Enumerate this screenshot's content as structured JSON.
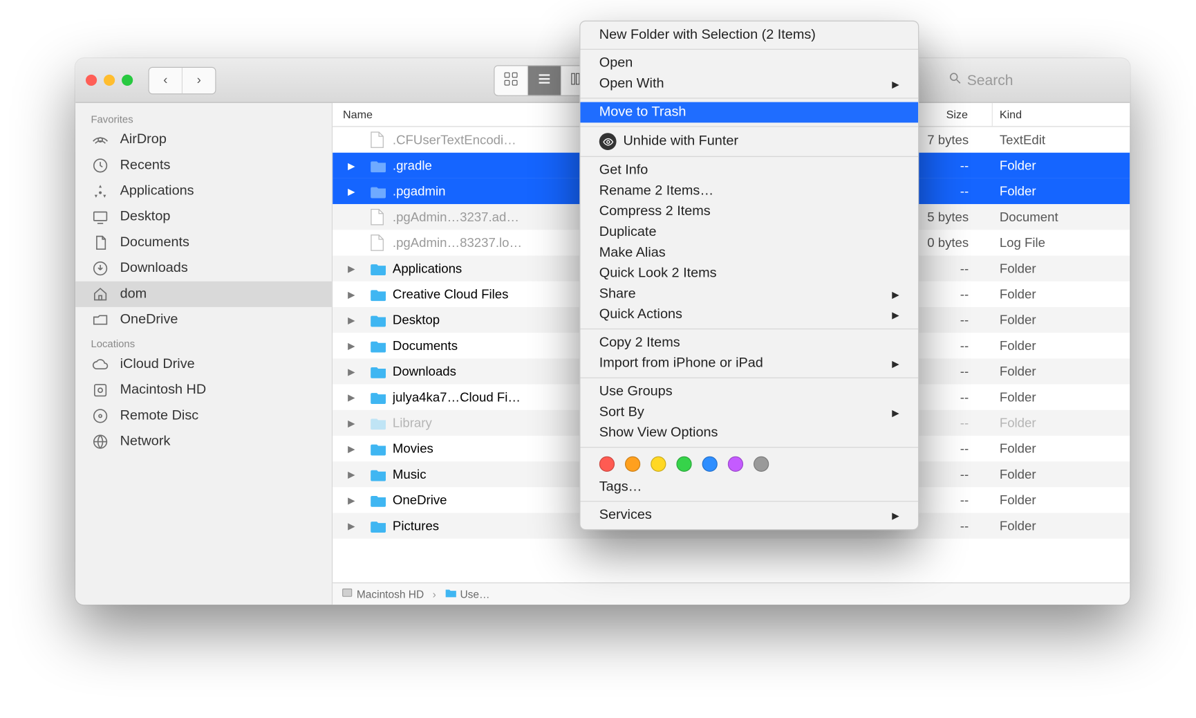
{
  "sidebar": {
    "groups": [
      {
        "header": "Favorites",
        "items": [
          {
            "icon": "airdrop",
            "label": "AirDrop"
          },
          {
            "icon": "recents",
            "label": "Recents"
          },
          {
            "icon": "apps",
            "label": "Applications"
          },
          {
            "icon": "desktop",
            "label": "Desktop"
          },
          {
            "icon": "documents",
            "label": "Documents"
          },
          {
            "icon": "downloads",
            "label": "Downloads"
          },
          {
            "icon": "home",
            "label": "dom",
            "selected": true
          },
          {
            "icon": "cloudfolder",
            "label": "OneDrive"
          }
        ]
      },
      {
        "header": "Locations",
        "items": [
          {
            "icon": "cloud",
            "label": "iCloud Drive"
          },
          {
            "icon": "disk",
            "label": "Macintosh HD"
          },
          {
            "icon": "remotedisc",
            "label": "Remote Disc"
          },
          {
            "icon": "network",
            "label": "Network"
          }
        ]
      }
    ]
  },
  "columns": {
    "name": "Name",
    "size": "Size",
    "kind": "Kind"
  },
  "rows": [
    {
      "expand": false,
      "sel": false,
      "type": "doc",
      "hidden": true,
      "name": ".CFUserTextEncodi…",
      "size": "7 bytes",
      "kind": "TextEdit"
    },
    {
      "expand": true,
      "sel": true,
      "type": "folder",
      "folderColor": "#1f6dff",
      "hidden": true,
      "name": ".gradle",
      "size": "--",
      "kind": "Folder"
    },
    {
      "expand": true,
      "sel": true,
      "type": "folder",
      "folderColor": "#1f6dff",
      "hidden": true,
      "name": ".pgadmin",
      "size": "--",
      "kind": "Folder"
    },
    {
      "expand": false,
      "sel": false,
      "type": "doc",
      "hidden": true,
      "name": ".pgAdmin…3237.ad…",
      "size": "5 bytes",
      "kind": "Document"
    },
    {
      "expand": false,
      "sel": false,
      "type": "doc",
      "hidden": true,
      "name": ".pgAdmin…83237.lo…",
      "size": "0 bytes",
      "kind": "Log File"
    },
    {
      "expand": true,
      "sel": false,
      "type": "folder",
      "name": "Applications",
      "size": "--",
      "kind": "Folder"
    },
    {
      "expand": true,
      "sel": false,
      "type": "folder",
      "name": "Creative Cloud Files",
      "size": "--",
      "kind": "Folder"
    },
    {
      "expand": true,
      "sel": false,
      "type": "folder",
      "name": "Desktop",
      "size": "--",
      "kind": "Folder"
    },
    {
      "expand": true,
      "sel": false,
      "type": "folder",
      "name": "Documents",
      "size": "--",
      "kind": "Folder"
    },
    {
      "expand": true,
      "sel": false,
      "type": "folder",
      "name": "Downloads",
      "size": "--",
      "kind": "Folder"
    },
    {
      "expand": true,
      "sel": false,
      "type": "folder",
      "name": "julya4ka7…Cloud Fi…",
      "size": "--",
      "kind": "Folder"
    },
    {
      "expand": true,
      "sel": false,
      "type": "folder",
      "hidden": true,
      "dim": true,
      "name": "Library",
      "size": "--",
      "kind": "Folder"
    },
    {
      "expand": true,
      "sel": false,
      "type": "folder",
      "name": "Movies",
      "size": "--",
      "kind": "Folder"
    },
    {
      "expand": true,
      "sel": false,
      "type": "folder",
      "name": "Music",
      "size": "--",
      "kind": "Folder"
    },
    {
      "expand": true,
      "sel": false,
      "type": "folder",
      "name": "OneDrive",
      "size": "--",
      "kind": "Folder"
    },
    {
      "expand": true,
      "sel": false,
      "type": "folder",
      "name": "Pictures",
      "size": "--",
      "kind": "Folder"
    }
  ],
  "pathbar": [
    "Macintosh HD",
    "Use…"
  ],
  "search_placeholder": "Search",
  "context_menu": {
    "highlighted_index": 3,
    "items": [
      {
        "label": "New Folder with Selection (2 Items)"
      },
      "---",
      {
        "label": "Open"
      },
      {
        "label": "Open With",
        "submenu": true
      },
      "---",
      {
        "label": "Move to Trash"
      },
      "---",
      {
        "label": "Unhide with Funter",
        "icon": "eye"
      },
      "---",
      {
        "label": "Get Info"
      },
      {
        "label": "Rename 2 Items…"
      },
      {
        "label": "Compress 2 Items"
      },
      {
        "label": "Duplicate"
      },
      {
        "label": "Make Alias"
      },
      {
        "label": "Quick Look 2 Items"
      },
      {
        "label": "Share",
        "submenu": true
      },
      {
        "label": "Quick Actions",
        "submenu": true
      },
      "---",
      {
        "label": "Copy 2 Items"
      },
      {
        "label": "Import from iPhone or iPad",
        "submenu": true
      },
      "---",
      {
        "label": "Use Groups"
      },
      {
        "label": "Sort By",
        "submenu": true
      },
      {
        "label": "Show View Options"
      },
      "---",
      {
        "type": "tags",
        "colors": [
          "#ff5b52",
          "#ffa01e",
          "#ffd824",
          "#36d34a",
          "#2e8eff",
          "#c45bff",
          "#9a9a9a"
        ]
      },
      {
        "label": "Tags…"
      },
      "---",
      {
        "label": "Services",
        "submenu": true
      }
    ]
  }
}
